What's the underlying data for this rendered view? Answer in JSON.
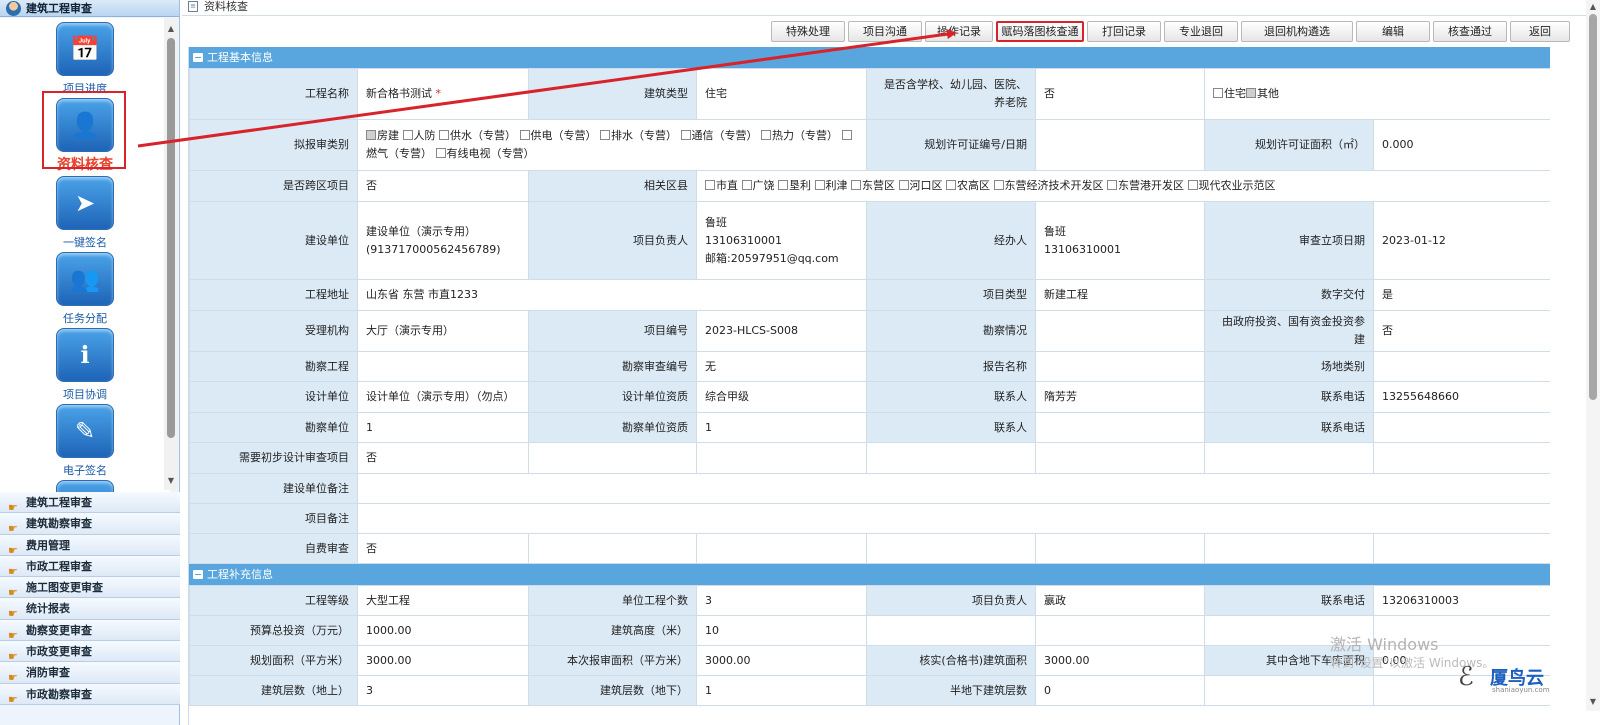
{
  "sidebar": {
    "header": "建筑工程审查",
    "icons": [
      {
        "label": "项目进度",
        "glyph": "📅"
      },
      {
        "label": "资料核查",
        "glyph": "👤"
      },
      {
        "label": "一键签名",
        "glyph": "➤"
      },
      {
        "label": "任务分配",
        "glyph": "👥"
      },
      {
        "label": "项目协调",
        "glyph": "ℹ"
      },
      {
        "label": "电子签名",
        "glyph": "✎"
      }
    ],
    "menu": [
      "建筑工程审查",
      "建筑勘察审查",
      "费用管理",
      "市政工程审查",
      "施工图变更审查",
      "统计报表",
      "勘察变更审查",
      "市政变更审查",
      "消防审查",
      "市政勘察审查"
    ]
  },
  "main": {
    "title": "资料核查",
    "toolbar": [
      "特殊处理",
      "项目沟通",
      "操作记录",
      "赋码落图核查通",
      "打回记录",
      "专业退回",
      "退回机构遴选",
      "编辑",
      "核查通过",
      "返回"
    ],
    "section1_title": "工程基本信息",
    "section2_title": "工程补充信息"
  },
  "basic": {
    "project_name_label": "工程名称",
    "project_name": "新合格书测试",
    "required_mark": "*",
    "building_type_label": "建筑类型",
    "building_type": "住宅",
    "school_label": "是否含学校、幼儿园、医院、养老院",
    "school_value": "否",
    "school_options": [
      "住宅",
      "其他"
    ],
    "report_type_label": "拟报审类别",
    "report_types": [
      "房建",
      "人防",
      "供水（专营）",
      "供电（专营）",
      "排水（专营）",
      "通信（专营）",
      "热力（专营）",
      "燃气（专营）",
      "有线电视（专营）"
    ],
    "permit_no_label": "规划许可证编号/日期",
    "permit_no": "",
    "permit_area_label": "规划许可证面积（㎡）",
    "permit_area": "0.000",
    "cross_region_label": "是否跨区项目",
    "cross_region": "否",
    "district_label": "相关区县",
    "districts": [
      "市直",
      "广饶",
      "垦利",
      "利津",
      "东营区",
      "河口区",
      "农高区",
      "东营经济技术开发区",
      "东营港开发区",
      "现代农业示范区"
    ],
    "builder_label": "建设单位",
    "builder": "建设单位（演示专用）(913717000562456789)",
    "manager_label": "项目负责人",
    "manager_name": "鲁班",
    "manager_phone": "13106310001",
    "manager_email": "邮箱:20597951@qq.com",
    "handler_label": "经办人",
    "handler_name": "鲁班",
    "handler_phone": "13106310001",
    "review_date_label": "审查立项日期",
    "review_date": "2023-01-12",
    "address_label": "工程地址",
    "address": "山东省 东营 市直1233",
    "project_type_label": "项目类型",
    "project_type": "新建工程",
    "digital_label": "数字交付",
    "digital": "是",
    "agency_label": "受理机构",
    "agency": "大厅（演示专用）",
    "project_no_label": "项目编号",
    "project_no": "2023-HLCS-S008",
    "survey_status_label": "勘察情况",
    "survey_status": "",
    "gov_invest_label": "由政府投资、国有资金投资参建",
    "gov_invest": "否",
    "survey_project_label": "勘察工程",
    "survey_project": "",
    "survey_no_label": "勘察审查编号",
    "survey_no": "无",
    "report_name_label": "报告名称",
    "report_name": "",
    "site_type_label": "场地类别",
    "site_type": "",
    "design_unit_label": "设计单位",
    "design_unit": "设计单位（演示专用）（勿点）",
    "design_qual_label": "设计单位资质",
    "design_qual": "综合甲级",
    "contact_label": "联系人",
    "design_contact": "隋芳芳",
    "phone_label": "联系电话",
    "design_phone": "13255648660",
    "survey_unit_label": "勘察单位",
    "survey_unit": "1",
    "survey_qual_label": "勘察单位资质",
    "survey_qual": "1",
    "survey_contact": "",
    "survey_phone": "",
    "prelim_label": "需要初步设计审查项目",
    "prelim": "否",
    "builder_note_label": "建设单位备注",
    "builder_note": "",
    "project_note_label": "项目备注",
    "project_note": "",
    "self_pay_label": "自费审查",
    "self_pay": "否"
  },
  "supplement": {
    "grade_label": "工程等级",
    "grade": "大型工程",
    "unit_count_label": "单位工程个数",
    "unit_count": "3",
    "manager_label": "项目负责人",
    "manager": "嬴政",
    "phone_label": "联系电话",
    "phone": "13206310003",
    "budget_label": "预算总投资（万元）",
    "budget": "1000.00",
    "height_label": "建筑高度（米）",
    "height": "10",
    "plan_area_label": "规划面积（平方米）",
    "plan_area": "3000.00",
    "report_area_label": "本次报审面积（平方米）",
    "report_area": "3000.00",
    "verified_area_label": "核实(合格书)建筑面积",
    "verified_area": "3000.00",
    "garage_label": "其中含地下车库面积",
    "garage": "0.00",
    "floors_up_label": "建筑层数（地上）",
    "floors_up": "3",
    "floors_down_label": "建筑层数（地下）",
    "floors_down": "1",
    "semi_label": "半地下建筑层数",
    "semi": "0"
  },
  "overlay": {
    "watermark_title": "激活 Windows",
    "watermark_sub": "转到\"设置\"以激活 Windows。",
    "brand_name": "厦鸟云",
    "brand_url": "shaniaoyun.com",
    "arrow_color": "#d8232a"
  }
}
